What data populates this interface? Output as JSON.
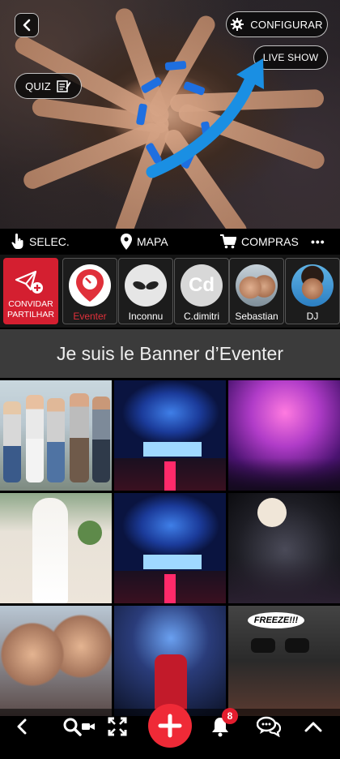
{
  "hero": {
    "config_label": "CONFIGURAR",
    "live_label": "LIVE SHOW",
    "quiz_label": "QUIZ",
    "arrow_color": "#1a8fe3"
  },
  "toolbar": {
    "select_label": "SELEC.",
    "map_label": "MAPA",
    "shop_label": "COMPRAS",
    "more_label": "•••"
  },
  "contacts": {
    "invite_line1": "CONVIDAR",
    "invite_line2": "PARTILHAR",
    "items": [
      {
        "label": "Eventer",
        "label_color": "#e0303a"
      },
      {
        "label": "Inconnu"
      },
      {
        "label": "C.dimitri",
        "initials": "Cd"
      },
      {
        "label": "Sebastian"
      },
      {
        "label": "DJ"
      }
    ]
  },
  "banner": {
    "text": "Je suis le Banner d’Eventer"
  },
  "grid": {
    "freeze_text": "FREEZE!!!"
  },
  "nav": {
    "notification_count": "8",
    "accent": "#ef2a37"
  }
}
